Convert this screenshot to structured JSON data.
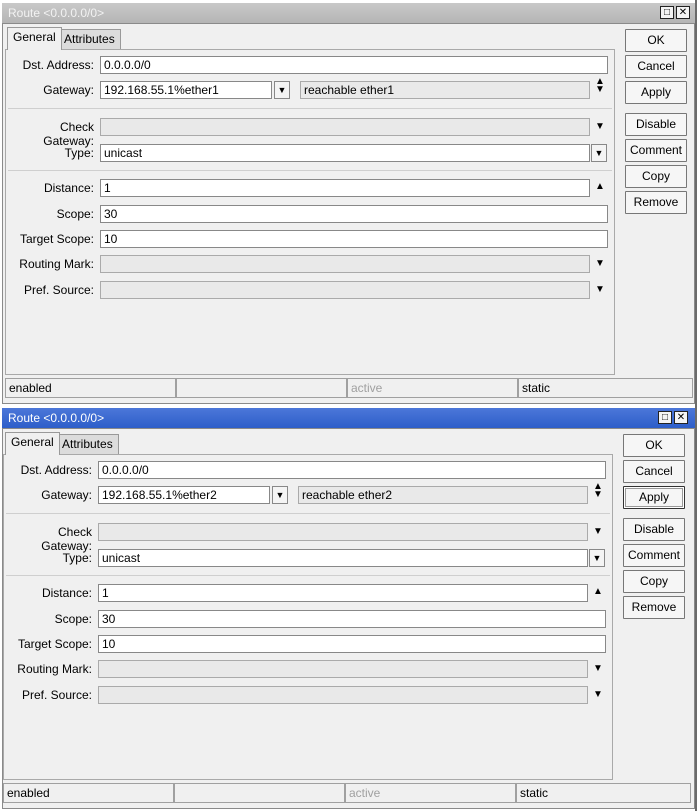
{
  "windows": [
    {
      "title": "Route <0.0.0.0/0>",
      "tabs": [
        "General",
        "Attributes"
      ],
      "fields": {
        "dst_address_label": "Dst. Address:",
        "dst_address": "0.0.0.0/0",
        "gateway_label": "Gateway:",
        "gateway": "192.168.55.1%ether1",
        "gateway_status": "reachable ether1",
        "check_gateway_label": "Check Gateway:",
        "check_gateway": "",
        "type_label": "Type:",
        "type": "unicast",
        "distance_label": "Distance:",
        "distance": "1",
        "scope_label": "Scope:",
        "scope": "30",
        "target_scope_label": "Target Scope:",
        "target_scope": "10",
        "routing_mark_label": "Routing Mark:",
        "routing_mark": "",
        "pref_source_label": "Pref. Source:",
        "pref_source": ""
      },
      "buttons": [
        "OK",
        "Cancel",
        "Apply",
        "Disable",
        "Comment",
        "Copy",
        "Remove"
      ],
      "status": [
        "enabled",
        "",
        "active",
        "static"
      ]
    },
    {
      "title": "Route <0.0.0.0/0>",
      "tabs": [
        "General",
        "Attributes"
      ],
      "fields": {
        "dst_address_label": "Dst. Address:",
        "dst_address": "0.0.0.0/0",
        "gateway_label": "Gateway:",
        "gateway": "192.168.55.1%ether2",
        "gateway_status": "reachable ether2",
        "check_gateway_label": "Check Gateway:",
        "check_gateway": "",
        "type_label": "Type:",
        "type": "unicast",
        "distance_label": "Distance:",
        "distance": "1",
        "scope_label": "Scope:",
        "scope": "30",
        "target_scope_label": "Target Scope:",
        "target_scope": "10",
        "routing_mark_label": "Routing Mark:",
        "routing_mark": "",
        "pref_source_label": "Pref. Source:",
        "pref_source": ""
      },
      "buttons": [
        "OK",
        "Cancel",
        "Apply",
        "Disable",
        "Comment",
        "Copy",
        "Remove"
      ],
      "status": [
        "enabled",
        "",
        "active",
        "static"
      ]
    }
  ],
  "icons": {
    "maximize": "maximize-icon",
    "close": "close-icon",
    "dropdown": "triangle-down-icon",
    "spinner": "spinner-icon"
  },
  "colors": {
    "inactive_titlebar": "#b8b8b8",
    "active_titlebar": "#2d5ec9",
    "window_bg": "#f0f0f0"
  }
}
